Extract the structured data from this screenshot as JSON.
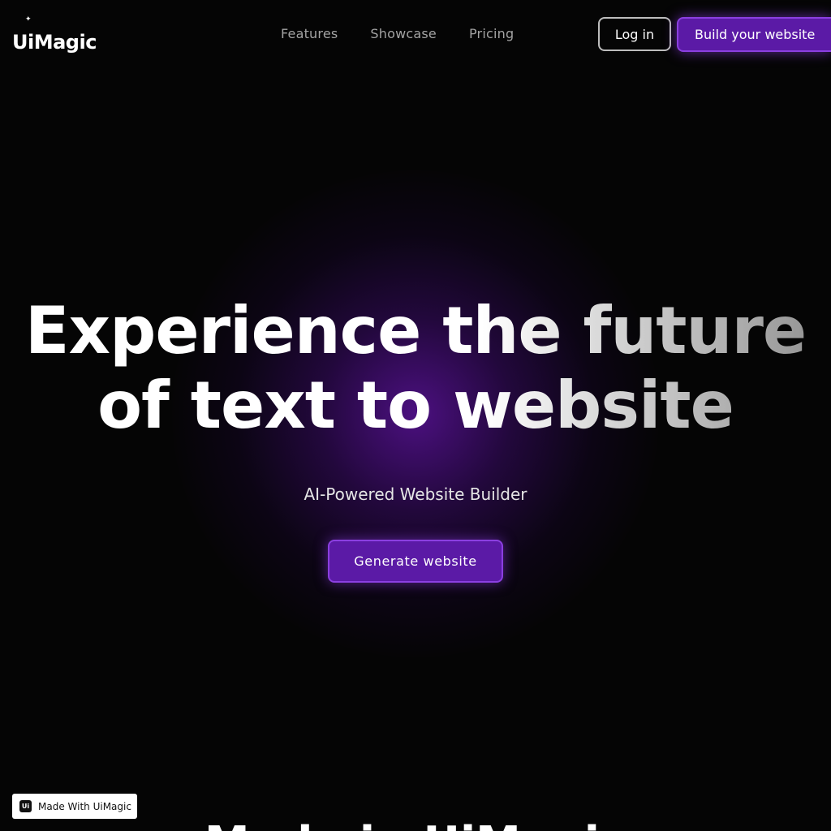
{
  "brand": {
    "name": "UiMagic",
    "accent": "#5b1aa6",
    "accent_border": "#8b3fe0",
    "background": "#050505"
  },
  "nav": {
    "links": [
      "Features",
      "Showcase",
      "Pricing"
    ],
    "login_label": "Log in",
    "cta_label": "Build your website"
  },
  "hero": {
    "title_line1": "Experience the future",
    "title_line2": "of text to website",
    "subtitle": "AI-Powered Website Builder",
    "cta_label": "Generate website"
  },
  "badge": {
    "logo_text": "Ui",
    "label": "Made With UiMagic"
  },
  "next_section": {
    "heading_partial": "Made in UiMagic"
  }
}
